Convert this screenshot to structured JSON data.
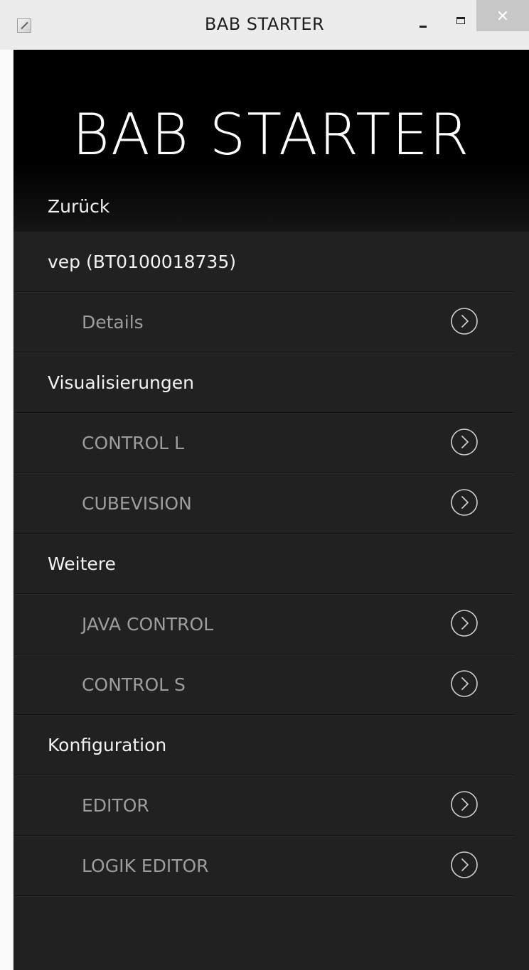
{
  "window": {
    "title": "BAB STARTER",
    "close_glyph": "✕",
    "icons": [
      "app-icon",
      "minimize-icon",
      "maximize-icon",
      "close-icon"
    ]
  },
  "header": {
    "brand": "BAB STARTER",
    "back_label": "Zurück"
  },
  "menu": {
    "device": {
      "label": "vep (BT0100018735)",
      "items": [
        {
          "label": "Details",
          "icon": "chevron-right-circle-icon"
        }
      ]
    },
    "visualisierungen": {
      "label": "Visualisierungen",
      "items": [
        {
          "label": "CONTROL L",
          "icon": "chevron-right-circle-icon"
        },
        {
          "label": "CUBEVISION",
          "icon": "chevron-right-circle-icon"
        }
      ]
    },
    "weitere": {
      "label": "Weitere",
      "items": [
        {
          "label": "JAVA CONTROL",
          "icon": "chevron-right-circle-icon"
        },
        {
          "label": "CONTROL S",
          "icon": "chevron-right-circle-icon"
        }
      ]
    },
    "konfiguration": {
      "label": "Konfiguration",
      "items": [
        {
          "label": "EDITOR",
          "icon": "chevron-right-circle-icon"
        },
        {
          "label": "LOGIK EDITOR",
          "icon": "chevron-right-circle-icon"
        }
      ]
    }
  },
  "colors": {
    "background": "#212121",
    "header": "#000000",
    "section_text": "#f2f2f2",
    "item_text": "#9d9d9d",
    "divider": "#111111"
  }
}
